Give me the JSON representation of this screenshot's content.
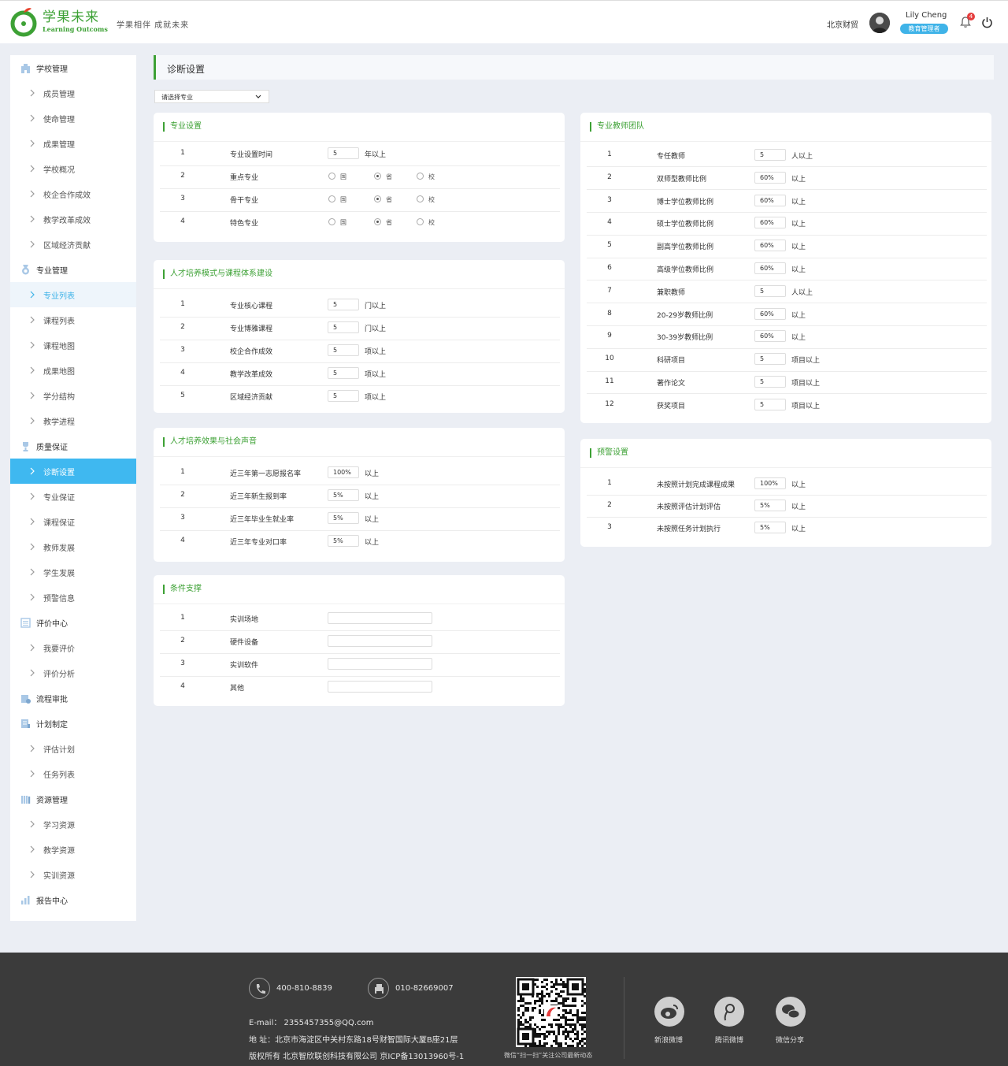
{
  "header": {
    "logo_cn": "学果未来",
    "logo_en": "Learning Outcoms",
    "slogan": "学果相伴 成就未来",
    "org": "北京财贸",
    "user_name": "Lily Cheng",
    "user_role": "教育管理者",
    "notifications": "4"
  },
  "sidebar": {
    "items": [
      {
        "label": "学校管理",
        "type": "section",
        "icon": "building-icon"
      },
      {
        "label": "成员管理",
        "type": "sub"
      },
      {
        "label": "使命管理",
        "type": "sub"
      },
      {
        "label": "成果管理",
        "type": "sub"
      },
      {
        "label": "学校概况",
        "type": "sub"
      },
      {
        "label": "校企合作成效",
        "type": "sub"
      },
      {
        "label": "教学改革成效",
        "type": "sub"
      },
      {
        "label": "区域经济贡献",
        "type": "sub"
      },
      {
        "label": "专业管理",
        "type": "section",
        "icon": "medal-icon"
      },
      {
        "label": "专业列表",
        "type": "sub",
        "state": "light"
      },
      {
        "label": "课程列表",
        "type": "sub"
      },
      {
        "label": "课程地图",
        "type": "sub"
      },
      {
        "label": "成果地图",
        "type": "sub"
      },
      {
        "label": "学分结构",
        "type": "sub"
      },
      {
        "label": "教学进程",
        "type": "sub"
      },
      {
        "label": "质量保证",
        "type": "section",
        "icon": "trophy-icon"
      },
      {
        "label": "诊断设置",
        "type": "sub",
        "state": "active"
      },
      {
        "label": "专业保证",
        "type": "sub"
      },
      {
        "label": "课程保证",
        "type": "sub"
      },
      {
        "label": "教师发展",
        "type": "sub"
      },
      {
        "label": "学生发展",
        "type": "sub"
      },
      {
        "label": "预警信息",
        "type": "sub"
      },
      {
        "label": "评价中心",
        "type": "section",
        "icon": "list-icon"
      },
      {
        "label": "我要评价",
        "type": "sub"
      },
      {
        "label": "评价分析",
        "type": "sub"
      },
      {
        "label": "流程审批",
        "type": "section",
        "icon": "approval-icon"
      },
      {
        "label": "计划制定",
        "type": "section",
        "icon": "plan-icon"
      },
      {
        "label": "评估计划",
        "type": "sub"
      },
      {
        "label": "任务列表",
        "type": "sub"
      },
      {
        "label": "资源管理",
        "type": "section",
        "icon": "books-icon"
      },
      {
        "label": "学习资源",
        "type": "sub"
      },
      {
        "label": "教学资源",
        "type": "sub"
      },
      {
        "label": "实训资源",
        "type": "sub"
      },
      {
        "label": "报告中心",
        "type": "section",
        "icon": "report-icon"
      }
    ]
  },
  "page": {
    "title": "诊断设置",
    "select_placeholder": "请选择专业"
  },
  "cards": {
    "major": {
      "title": "专业设置",
      "rows": [
        {
          "num": "1",
          "label": "专业设置时间",
          "value": "5",
          "unit": "年以上"
        },
        {
          "num": "2",
          "label": "重点专业",
          "options": [
            "国",
            "省",
            "校"
          ],
          "selected": 1
        },
        {
          "num": "3",
          "label": "骨干专业",
          "options": [
            "国",
            "省",
            "校"
          ],
          "selected": 1
        },
        {
          "num": "4",
          "label": "特色专业",
          "options": [
            "国",
            "省",
            "校"
          ],
          "selected": 1
        }
      ]
    },
    "talent": {
      "title": "人才培养模式与课程体系建设",
      "rows": [
        {
          "num": "1",
          "label": "专业核心课程",
          "value": "5",
          "unit": "门以上"
        },
        {
          "num": "2",
          "label": "专业博雅课程",
          "value": "5",
          "unit": "门以上"
        },
        {
          "num": "3",
          "label": "校企合作成效",
          "value": "5",
          "unit": "项以上"
        },
        {
          "num": "4",
          "label": "教学改革成效",
          "value": "5",
          "unit": "项以上"
        },
        {
          "num": "5",
          "label": "区域经济贡献",
          "value": "5",
          "unit": "项以上"
        }
      ]
    },
    "effect": {
      "title": "人才培养效果与社会声音",
      "rows": [
        {
          "num": "1",
          "label": "近三年第一志愿报名率",
          "value": "100%",
          "unit": "以上"
        },
        {
          "num": "2",
          "label": "近三年新生报到率",
          "value": "5%",
          "unit": "以上"
        },
        {
          "num": "3",
          "label": "近三年毕业生就业率",
          "value": "5%",
          "unit": "以上"
        },
        {
          "num": "4",
          "label": "近三年专业对口率",
          "value": "5%",
          "unit": "以上"
        }
      ]
    },
    "condition": {
      "title": "条件支撑",
      "rows": [
        {
          "num": "1",
          "label": "实训场地",
          "value": ""
        },
        {
          "num": "2",
          "label": "硬件设备",
          "value": ""
        },
        {
          "num": "3",
          "label": "实训软件",
          "value": ""
        },
        {
          "num": "4",
          "label": "其他",
          "value": ""
        }
      ]
    },
    "teachers": {
      "title": "专业教师团队",
      "rows": [
        {
          "num": "1",
          "label": "专任教师",
          "value": "5",
          "unit": "人以上"
        },
        {
          "num": "2",
          "label": "双师型教师比例",
          "value": "60%",
          "unit": "以上"
        },
        {
          "num": "3",
          "label": "博士学位教师比例",
          "value": "60%",
          "unit": "以上"
        },
        {
          "num": "4",
          "label": "硕士学位教师比例",
          "value": "60%",
          "unit": "以上"
        },
        {
          "num": "5",
          "label": "副高学位教师比例",
          "value": "60%",
          "unit": "以上"
        },
        {
          "num": "6",
          "label": "高级学位教师比例",
          "value": "60%",
          "unit": "以上"
        },
        {
          "num": "7",
          "label": "兼职教师",
          "value": "5",
          "unit": "人以上"
        },
        {
          "num": "8",
          "label": "20-29岁教师比例",
          "value": "60%",
          "unit": "以上"
        },
        {
          "num": "9",
          "label": "30-39岁教师比例",
          "value": "60%",
          "unit": "以上"
        },
        {
          "num": "10",
          "label": "科研项目",
          "value": "5",
          "unit": "项目以上"
        },
        {
          "num": "11",
          "label": "著作论文",
          "value": "5",
          "unit": "项目以上"
        },
        {
          "num": "12",
          "label": "获奖项目",
          "value": "5",
          "unit": "项目以上"
        }
      ]
    },
    "warning": {
      "title": "预警设置",
      "rows": [
        {
          "num": "1",
          "label": "未按照计划完成课程成果",
          "value": "100%",
          "unit": "以上"
        },
        {
          "num": "2",
          "label": "未按照评估计划评估",
          "value": "5%",
          "unit": "以上"
        },
        {
          "num": "3",
          "label": "未按照任务计划执行",
          "value": "5%",
          "unit": "以上"
        }
      ]
    }
  },
  "footer": {
    "phone": "400-810-8839",
    "fax": "010-82669007",
    "email": "E-mail： 2355457355@QQ.com",
    "address": "地 址：北京市海淀区中关村东路18号财智国际大厦B座21层",
    "copyright": "版权所有 北京智欣联创科技有限公司 京ICP备13013960号-1",
    "qr_caption": "微信“扫一扫”关注公司最新动态",
    "social": [
      "新浪微博",
      "腾讯微博",
      "微信分享"
    ]
  },
  "colors": {
    "accent": "#3da135",
    "active": "#3fb8f0",
    "footer": "#3b3b3b"
  }
}
